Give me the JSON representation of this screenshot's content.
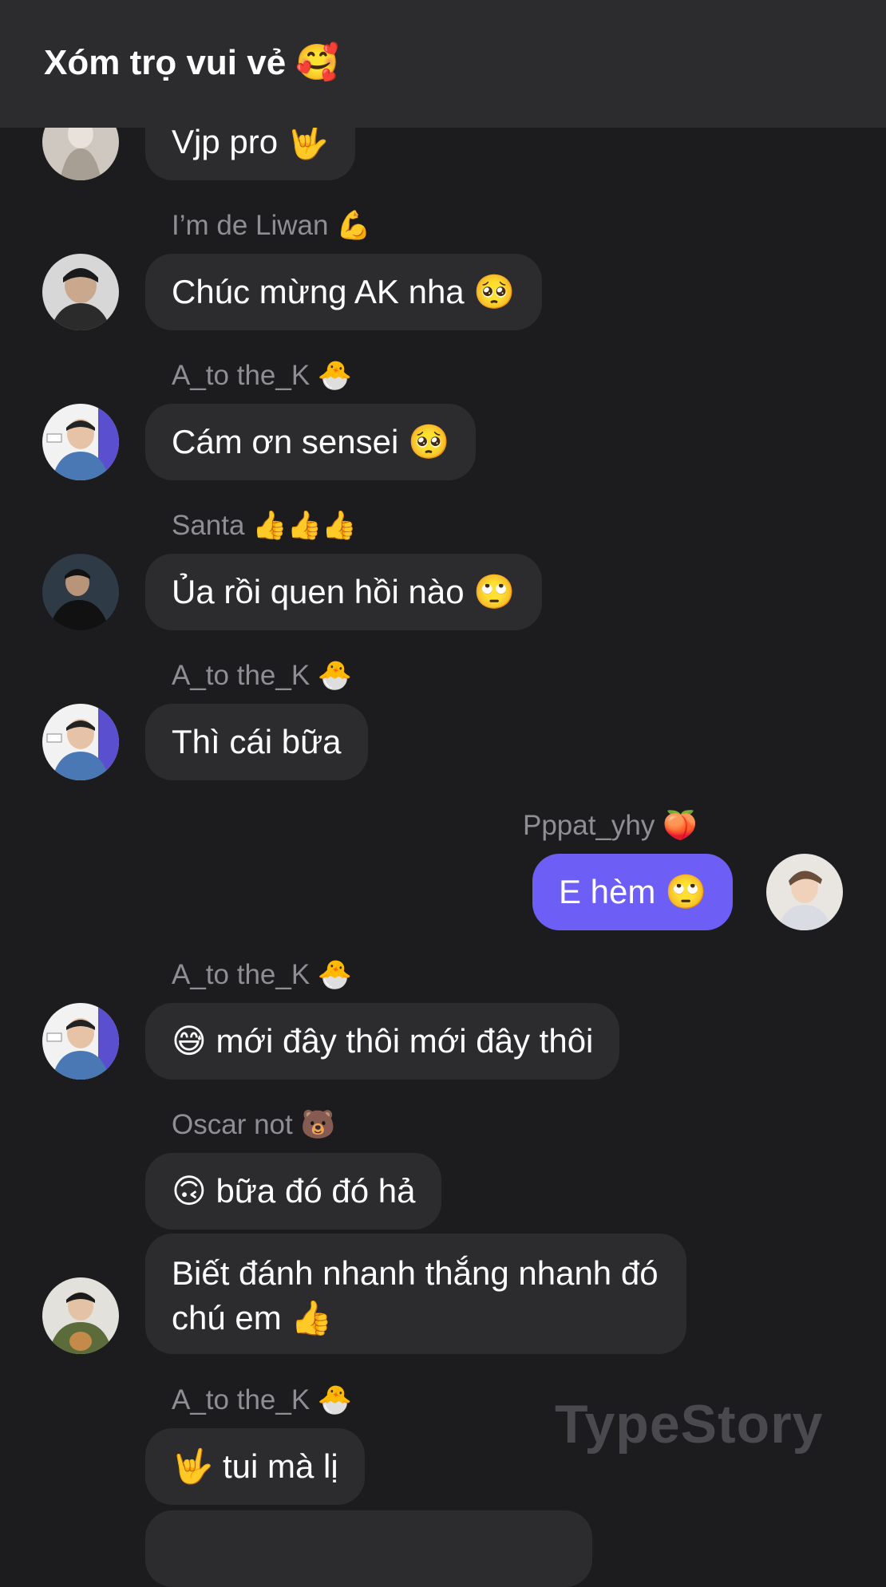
{
  "header": {
    "title": "Xóm trọ vui vẻ 🥰"
  },
  "messages": [
    {
      "sender": "",
      "text": "Vjp pro 🤟"
    },
    {
      "sender": "I’m de Liwan 💪",
      "text": "Chúc mừng AK nha 🥺"
    },
    {
      "sender": "A_to the_K 🐣",
      "text": "Cám ơn sensei 🥺"
    },
    {
      "sender": "Santa 👍👍👍",
      "text": "Ủa rồi quen hồi nào 🙄"
    },
    {
      "sender": "A_to the_K 🐣",
      "text": "Thì cái bữa"
    },
    {
      "sender": "Pppat_yhy 🍑",
      "text": "E hèm 🙄"
    },
    {
      "sender": "A_to the_K 🐣",
      "text": "😅 mới đây thôi mới đây thôi"
    },
    {
      "sender": "Oscar not 🐻",
      "text": "🙃 bữa đó đó hả"
    },
    {
      "sender": "",
      "text": "Biết đánh nhanh thắng nhanh đó chú em 👍"
    },
    {
      "sender": "A_to the_K 🐣",
      "text": "🤟 tui mà lị"
    },
    {
      "sender": "",
      "text": ""
    }
  ],
  "watermark": "TypeStory",
  "colors": {
    "background": "#1c1c1e",
    "header": "#2c2c2e",
    "bubble_incoming": "#2c2c2e",
    "bubble_outgoing": "#6d5ff5",
    "sender_name": "#8e8e93"
  }
}
